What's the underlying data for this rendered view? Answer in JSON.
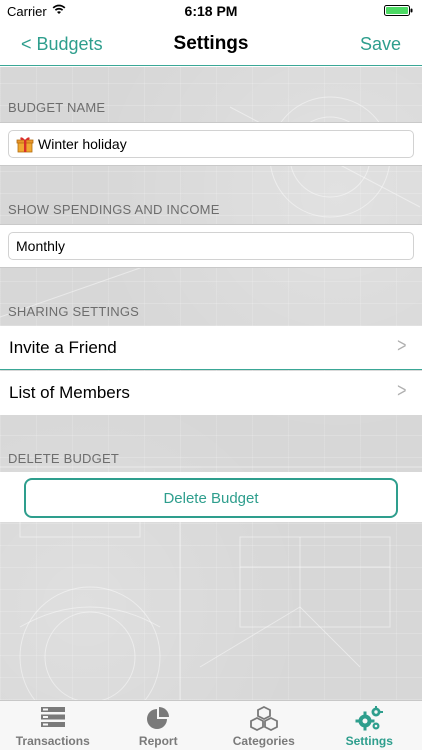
{
  "status_bar": {
    "carrier": "Carrier",
    "time": "6:18 PM"
  },
  "nav": {
    "back_label": "< Budgets",
    "title": "Settings",
    "save_label": "Save"
  },
  "sections": {
    "budget_name": {
      "label": "BUDGET NAME",
      "value": "Winter holiday"
    },
    "show_spendings": {
      "label": "SHOW SPENDINGS AND INCOME",
      "value": "Monthly"
    },
    "sharing": {
      "label": "SHARING SETTINGS",
      "items": [
        {
          "label": "Invite a Friend"
        },
        {
          "label": "List of Members"
        }
      ]
    },
    "delete": {
      "label": "DELETE BUDGET",
      "button_label": "Delete Budget"
    }
  },
  "tabs": [
    {
      "label": "Transactions",
      "icon": "transactions-icon",
      "active": false
    },
    {
      "label": "Report",
      "icon": "report-pie-icon",
      "active": false
    },
    {
      "label": "Categories",
      "icon": "categories-cubes-icon",
      "active": false
    },
    {
      "label": "Settings",
      "icon": "gears-icon",
      "active": true
    }
  ],
  "colors": {
    "accent": "#2e9e8d",
    "inactive": "#7a7a7a",
    "background": "#d7d7d7"
  }
}
